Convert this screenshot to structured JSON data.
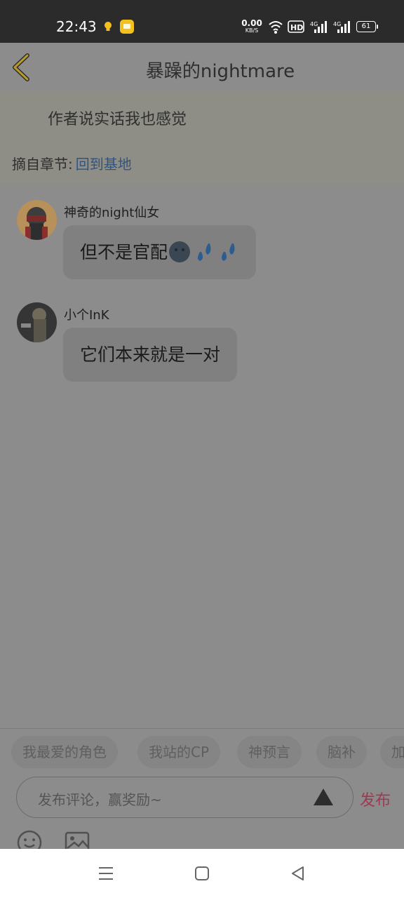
{
  "status_bar": {
    "time": "22:43",
    "net_speed_value": "0.00",
    "net_speed_unit": "KB/S",
    "hd_label": "HD",
    "signal1_label": "4G",
    "signal2_label": "4G",
    "battery": "61"
  },
  "header": {
    "title": "暴躁的nightmare",
    "back_icon": "chevron-left-icon"
  },
  "quote": {
    "text": "作者说实话我也感觉",
    "chapter_label": "摘自章节:",
    "chapter_link": "回到基地"
  },
  "comments": [
    {
      "author": "神奇的night仙女",
      "text": "但不是官配",
      "emoji": [
        "new-moon-face",
        "sweat-droplets",
        "sweat-droplets"
      ]
    },
    {
      "author": "小个InK",
      "text": "它们本来就是一对",
      "emoji": []
    }
  ],
  "quick_tags": [
    "我最爱的角色",
    "我站的CP",
    "神预言",
    "脑补",
    "加"
  ],
  "composer": {
    "placeholder": "发布评论，赢奖励~",
    "publish_label": "发布",
    "tools": [
      "emoji-icon",
      "image-icon"
    ]
  },
  "system_nav": [
    "menu-icon",
    "home-icon",
    "back-icon"
  ],
  "colors": {
    "accent_yellow": "#f4c01e",
    "link_blue": "#32547c",
    "publish_red": "#9a3b50"
  }
}
